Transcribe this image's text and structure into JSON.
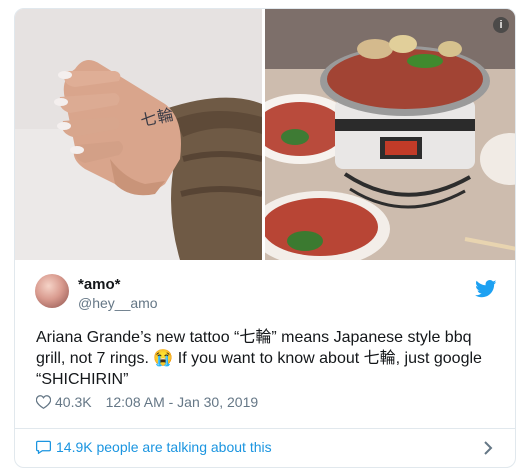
{
  "tweet": {
    "author_name": "*amo*",
    "author_handle": "@hey__amo",
    "text": "Ariana Grande’s new tattoo “七輪” means Japanese style bbq grill, not 7 rings. 😭 If you want to know about 七輪, just google “SHICHIRIN”",
    "likes": "40.3K",
    "timestamp": "12:08 AM - Jan 30, 2019",
    "footer_text": "14.9K people are talking about this",
    "accent_color": "#1b95e0"
  },
  "media": {
    "left_photo_text": "七輪",
    "info_badge": "i"
  },
  "icons": {
    "bird": "twitter-bird-icon",
    "heart": "heart-icon",
    "bubble": "speech-bubble-icon",
    "chevron": "chevron-right-icon"
  }
}
